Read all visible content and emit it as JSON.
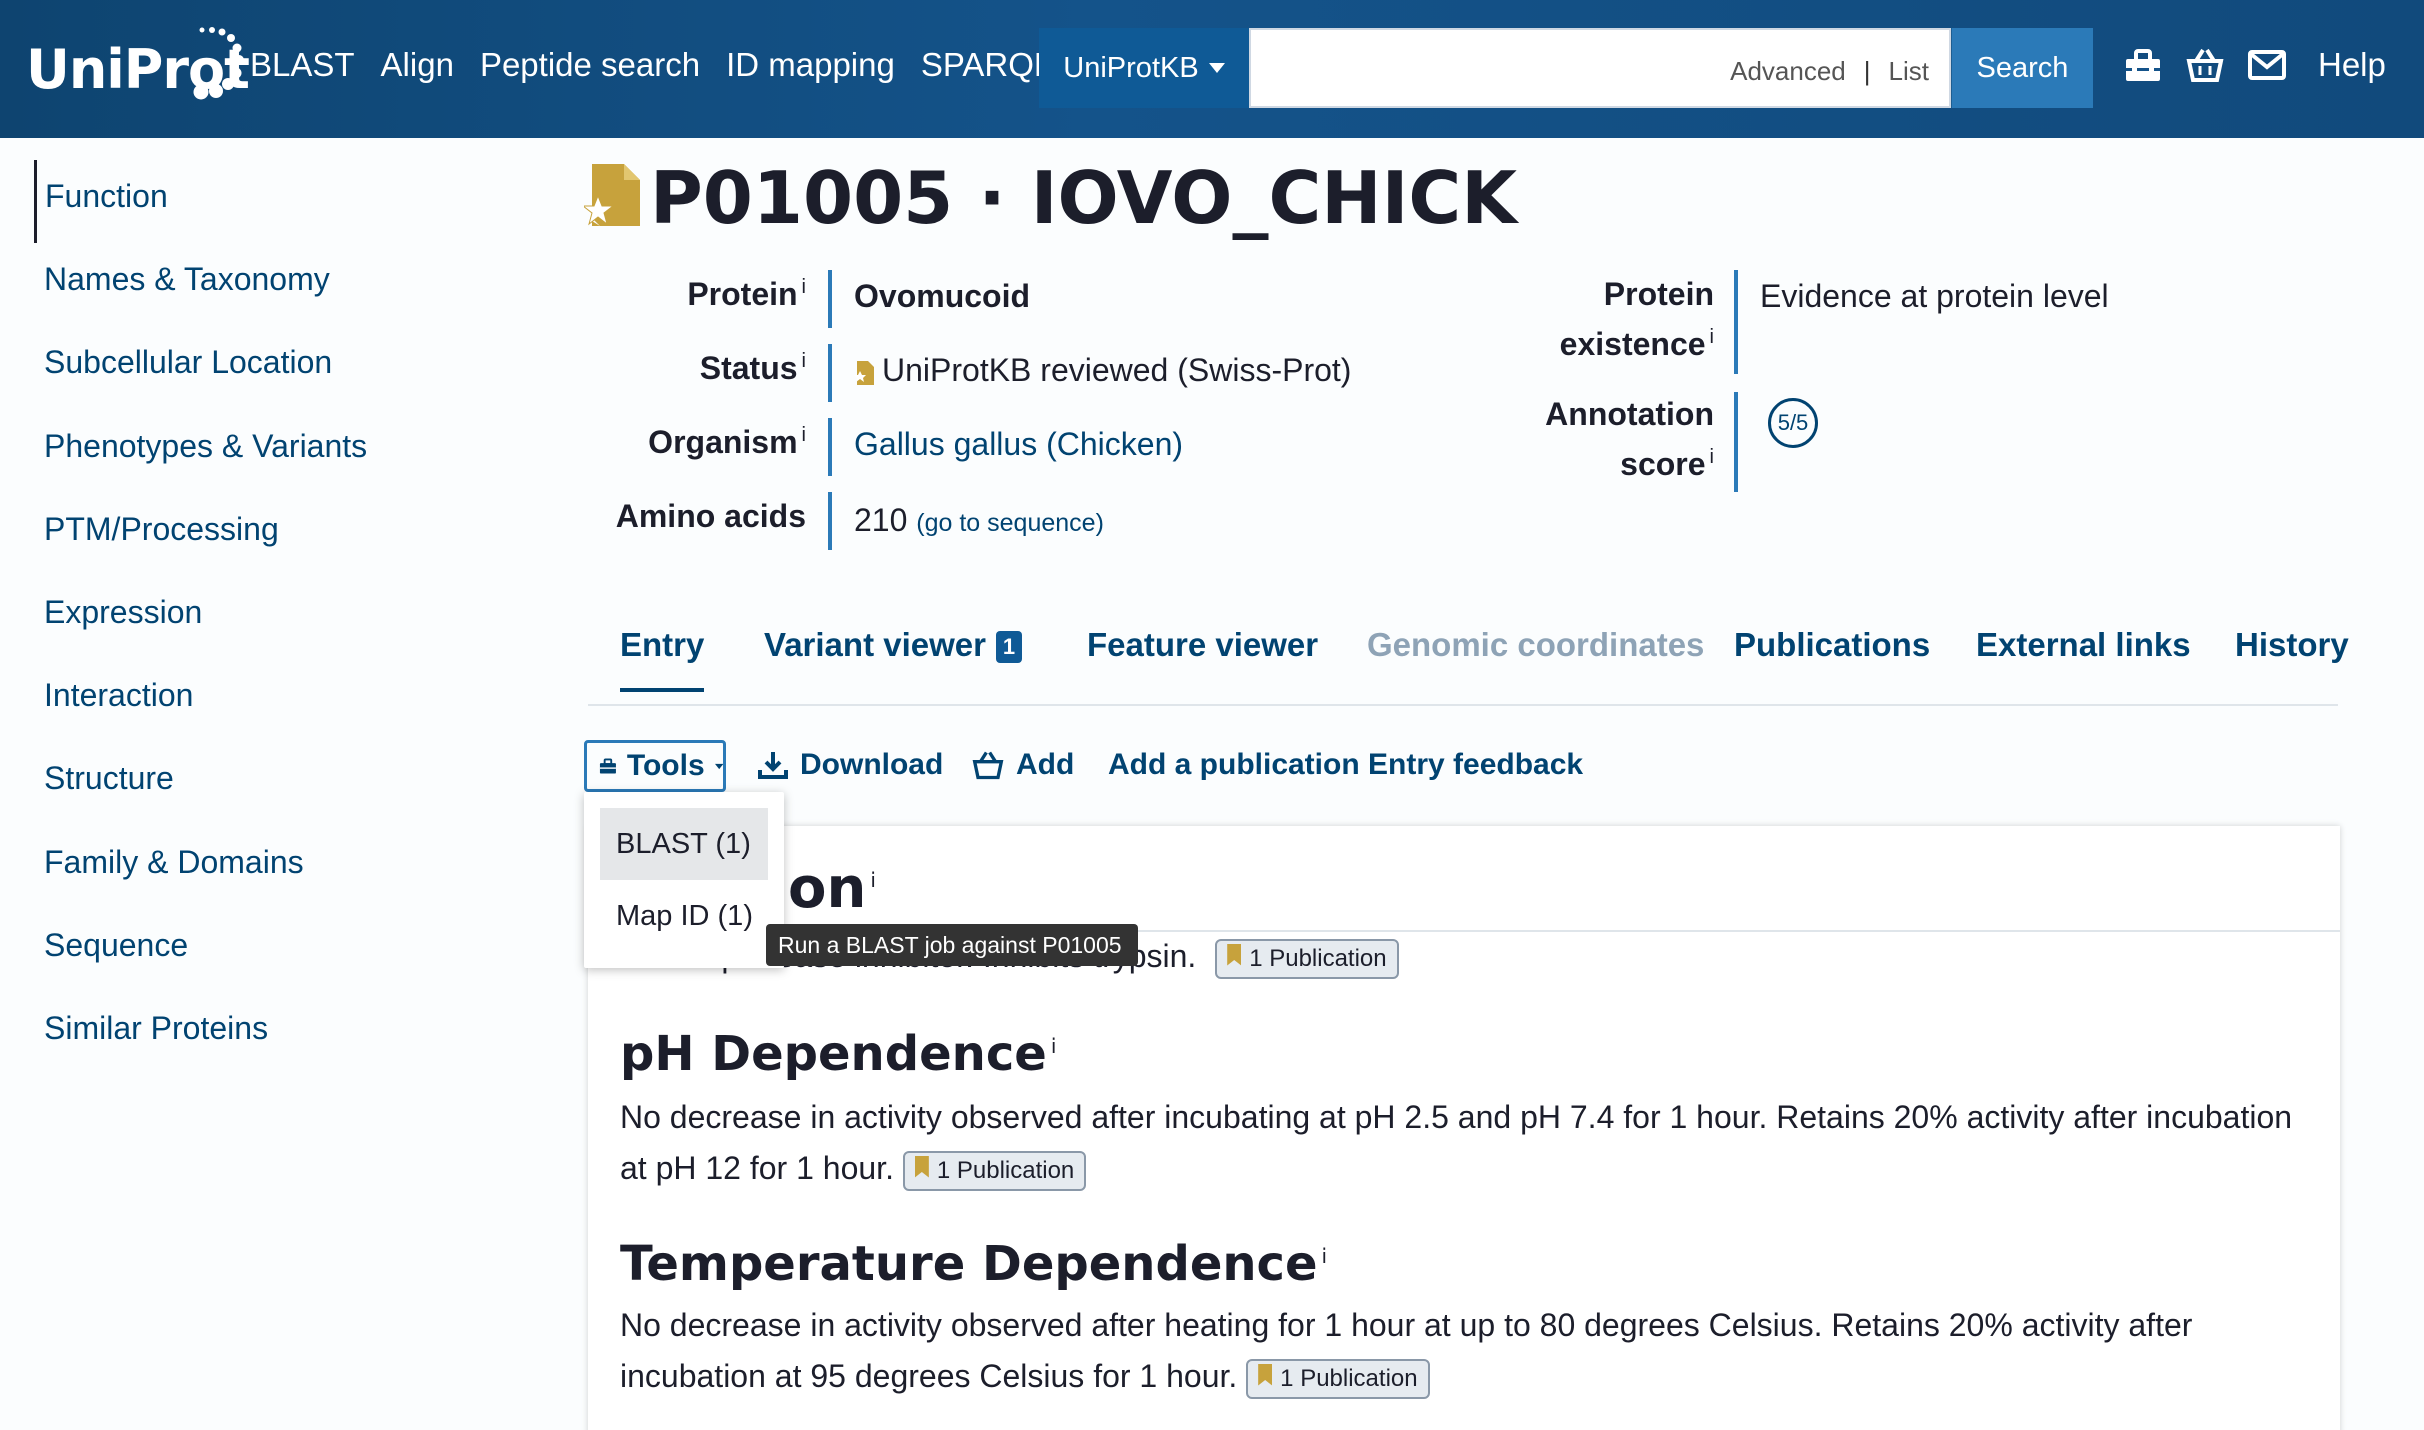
{
  "header": {
    "logo_text": "UniProt",
    "nav": [
      "BLAST",
      "Align",
      "Peptide search",
      "ID mapping",
      "SPARQL"
    ],
    "db_select": "UniProtKB",
    "search_placeholder": "",
    "search_links": {
      "advanced": "Advanced",
      "separator": "|",
      "list": "List"
    },
    "search_button": "Search",
    "help": "Help",
    "icons": [
      "tools-icon",
      "basket-icon",
      "mail-icon"
    ]
  },
  "sidebar": {
    "items": [
      {
        "label": "Function",
        "active": true
      },
      {
        "label": "Names & Taxonomy"
      },
      {
        "label": "Subcellular Location"
      },
      {
        "label": "Phenotypes & Variants"
      },
      {
        "label": "PTM/Processing"
      },
      {
        "label": "Expression"
      },
      {
        "label": "Interaction"
      },
      {
        "label": "Structure"
      },
      {
        "label": "Family & Domains"
      },
      {
        "label": "Sequence"
      },
      {
        "label": "Similar Proteins"
      }
    ]
  },
  "entry": {
    "title": "P01005 · IOVO_CHICK",
    "info_sup": "i",
    "protein_label": "Protein",
    "protein_value": "Ovomucoid",
    "status_label": "Status",
    "status_value": "UniProtKB reviewed (Swiss-Prot)",
    "organism_label": "Organism",
    "organism_value": "Gallus gallus (Chicken)",
    "amino_label": "Amino acids",
    "amino_value": "210",
    "amino_link": "(go to sequence)",
    "existence_label_1": "Protein",
    "existence_label_2": "existence",
    "existence_value": "Evidence at protein level",
    "annotation_label_1": "Annotation",
    "annotation_label_2": "score",
    "annotation_value": "5/5"
  },
  "tabs": [
    {
      "label": "Entry",
      "active": true
    },
    {
      "label": "Variant viewer",
      "badge": "1"
    },
    {
      "label": "Feature viewer"
    },
    {
      "label": "Genomic coordinates",
      "disabled": true
    },
    {
      "label": "Publications"
    },
    {
      "label": "External links"
    },
    {
      "label": "History"
    }
  ],
  "toolbar": {
    "tools": "Tools",
    "download": "Download",
    "add": "Add",
    "add_publication": "Add a publication",
    "feedback": "Entry feedback"
  },
  "dropdown": {
    "items": [
      "BLAST (1)",
      "Map ID (1)"
    ],
    "tooltip": "Run a BLAST job against P01005"
  },
  "card": {
    "title_visible": "on",
    "function_text": "Serine protease inhibitor. Inhibits trypsin.",
    "publication_label": "1 Publication",
    "ph_title": "pH Dependence",
    "ph_text": "No decrease in activity observed after incubating at pH 2.5 and pH 7.4 for 1 hour. Retains 20% activity after incubation at pH 12 for 1 hour.",
    "temp_title": "Temperature Dependence",
    "temp_text": "No decrease in activity observed after heating for 1 hour at up to 80 degrees Celsius. Retains 20% activity after incubation at 95 degrees Celsius for 1 hour."
  },
  "colors": {
    "brand": "#14538a",
    "link": "#014371",
    "accent": "#2b7ab8",
    "gold": "#c7a23c"
  }
}
